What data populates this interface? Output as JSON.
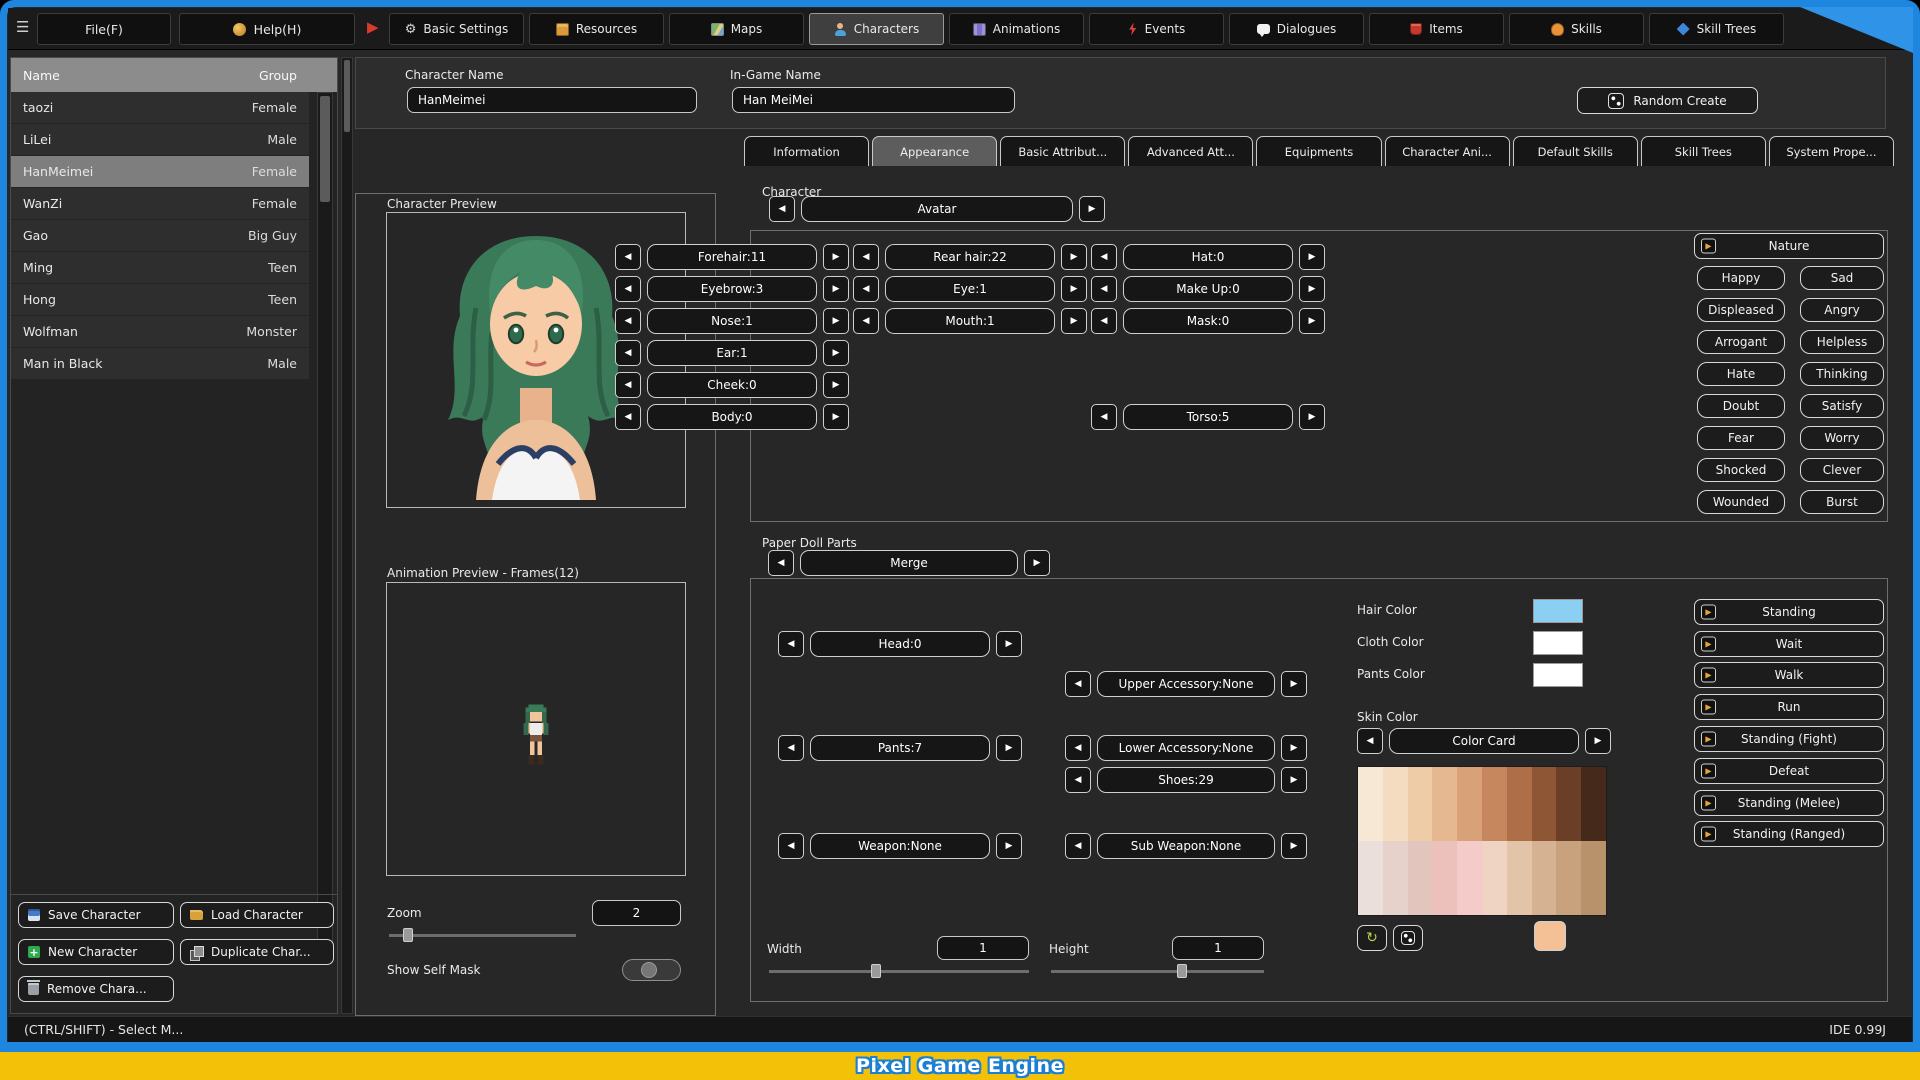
{
  "icons": {
    "hamburger": "☰",
    "play_arrow": "▶",
    "left_arrow": "◀",
    "right_arrow": "▶",
    "refresh": "↻",
    "gear": "⚙",
    "plus": "+"
  },
  "titlebar": {
    "file_menu": "File(F)",
    "help_menu": "Help(H)",
    "nav_tabs": [
      {
        "label": "Basic Settings"
      },
      {
        "label": "Resources"
      },
      {
        "label": "Maps"
      },
      {
        "label": "Characters"
      },
      {
        "label": "Animations"
      },
      {
        "label": "Events"
      },
      {
        "label": "Dialogues"
      },
      {
        "label": "Items"
      },
      {
        "label": "Skills"
      },
      {
        "label": "Skill Trees"
      }
    ]
  },
  "character_list": {
    "columns": {
      "name": "Name",
      "group": "Group"
    },
    "rows": [
      {
        "name": "taozi",
        "group": "Female"
      },
      {
        "name": "LiLei",
        "group": "Male"
      },
      {
        "name": "HanMeimei",
        "group": "Female"
      },
      {
        "name": "WanZi",
        "group": "Female"
      },
      {
        "name": "Gao",
        "group": "Big Guy"
      },
      {
        "name": "Ming",
        "group": "Teen"
      },
      {
        "name": "Hong",
        "group": "Teen"
      },
      {
        "name": "Wolfman",
        "group": "Monster"
      },
      {
        "name": "Man in Black",
        "group": "Male"
      }
    ],
    "selected_row": "HanMeimei",
    "actions": {
      "save": "Save Character",
      "load": "Load Character",
      "new": "New Character",
      "duplicate": "Duplicate Char...",
      "remove": "Remove Chara..."
    }
  },
  "character_form": {
    "name_label": "Character Name",
    "name_value": "HanMeimei",
    "ingame_label": "In-Game Name",
    "ingame_value": "Han MeiMei",
    "random_create": "Random Create"
  },
  "editor_tabs": [
    "Information",
    "Appearance",
    "Basic Attribut...",
    "Advanced Att...",
    "Equipments",
    "Character Ani...",
    "Default Skills",
    "Skill Trees",
    "System Prope..."
  ],
  "editor_active_tab": "Appearance",
  "preview": {
    "character_title": "Character Preview",
    "animation_title": "Animation Preview - Frames(12)",
    "zoom_label": "Zoom",
    "zoom_value": "2",
    "show_self_mask_label": "Show Self Mask"
  },
  "appearance": {
    "section_title": "Character",
    "avatar_spinner": "Avatar",
    "face_spinners": [
      "Forehair:11",
      "Rear hair:22",
      "Hat:0",
      "Eyebrow:3",
      "Eye:1",
      "Make Up:0",
      "Nose:1",
      "Mouth:1",
      "Mask:0",
      "Ear:1",
      "Cheek:0",
      "Body:0",
      "Torso:5"
    ],
    "emotions": [
      "Nature",
      "Happy",
      "Sad",
      "Displeased",
      "Angry",
      "Arrogant",
      "Helpless",
      "Hate",
      "Thinking",
      "Doubt",
      "Satisfy",
      "Fear",
      "Worry",
      "Shocked",
      "Clever",
      "Wounded",
      "Burst"
    ],
    "paper_doll_title": "Paper Doll Parts",
    "merge_spinner": "Merge",
    "doll_spinners": [
      "Head:0",
      "Upper Accessory:None",
      "Pants:7",
      "Lower Accessory:None",
      "Shoes:29",
      "Weapon:None",
      "Sub Weapon:None"
    ],
    "colors": {
      "hair_label": "Hair Color",
      "hair_value": "#8bd0f2",
      "cloth_label": "Cloth Color",
      "cloth_value": "#ffffff",
      "pants_label": "Pants Color",
      "pants_value": "#ffffff",
      "skin_label": "Skin Color",
      "color_card": "Color Card",
      "selected_skin": "#f4c096",
      "palette_row1": [
        "#f6e8d4",
        "#f3dcc0",
        "#eecca8",
        "#e6b891",
        "#d8a178",
        "#c6875e",
        "#ad6e48",
        "#8f5636",
        "#6b3f27",
        "#45291a"
      ],
      "palette_row2": [
        "#eadfda",
        "#e6d2cb",
        "#e2c6bd",
        "#ecc0bb",
        "#f4cbc8",
        "#efd4c4",
        "#e2c4a9",
        "#d5b392",
        "#c7a27d",
        "#b8926a"
      ]
    },
    "animations": [
      "Standing",
      "Wait",
      "Walk",
      "Run",
      "Standing (Fight)",
      "Defeat",
      "Standing (Melee)",
      "Standing (Ranged)"
    ],
    "size": {
      "width_label": "Width",
      "width_value": "1",
      "height_label": "Height",
      "height_value": "1"
    }
  },
  "statusbar": {
    "left": "(CTRL/SHIFT) - Select M...",
    "right": "IDE 0.99J"
  },
  "banner": {
    "title": "Pixel Game Engine"
  }
}
